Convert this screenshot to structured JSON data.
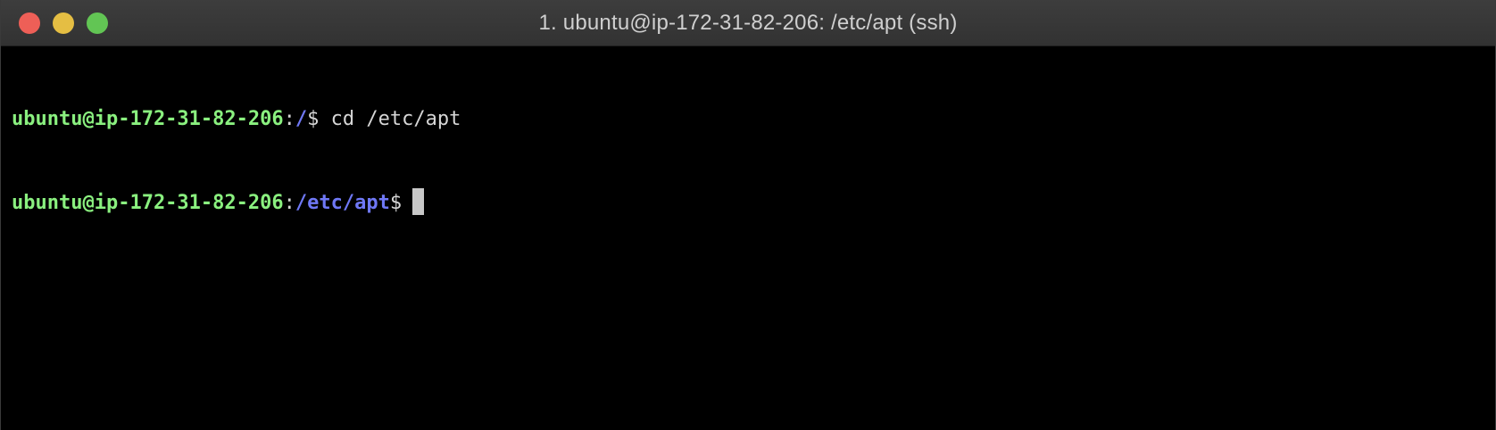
{
  "window": {
    "title": "1. ubuntu@ip-172-31-82-206: /etc/apt (ssh)",
    "buttons": {
      "close_color": "#ee5f57",
      "minimize_color": "#e5be43",
      "zoom_color": "#62c554"
    }
  },
  "colors": {
    "user": "#8af07f",
    "path": "#6f78f6",
    "text": "#d6d6d6",
    "cursor": "#c8c8c8"
  },
  "terminal": {
    "lines": [
      {
        "user_host": "ubuntu@ip-172-31-82-206",
        "sep": ":",
        "path": "/",
        "prompt": "$ ",
        "command": "cd /etc/apt"
      },
      {
        "user_host": "ubuntu@ip-172-31-82-206",
        "sep": ":",
        "path": "/etc/apt",
        "prompt": "$",
        "command": ""
      }
    ]
  }
}
